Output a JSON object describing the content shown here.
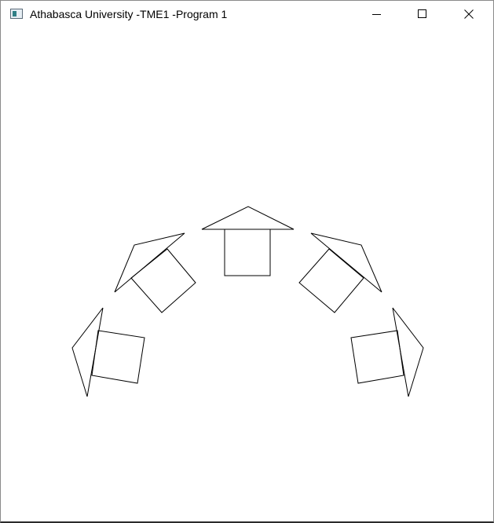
{
  "window": {
    "title": "Athabasca University -TME1 -Program 1",
    "app_icon": "window-app-icon",
    "buttons": [
      {
        "name": "minimize",
        "icon": "minimize-icon"
      },
      {
        "name": "maximize",
        "icon": "maximize-icon"
      },
      {
        "name": "close",
        "icon": "close-icon"
      }
    ]
  },
  "canvas": {
    "background": "#ffffff",
    "stroke_color": "#000000",
    "houses": [
      {
        "id": "house-1"
      },
      {
        "id": "house-2"
      },
      {
        "id": "house-3"
      },
      {
        "id": "house-4"
      },
      {
        "id": "house-5"
      }
    ]
  }
}
